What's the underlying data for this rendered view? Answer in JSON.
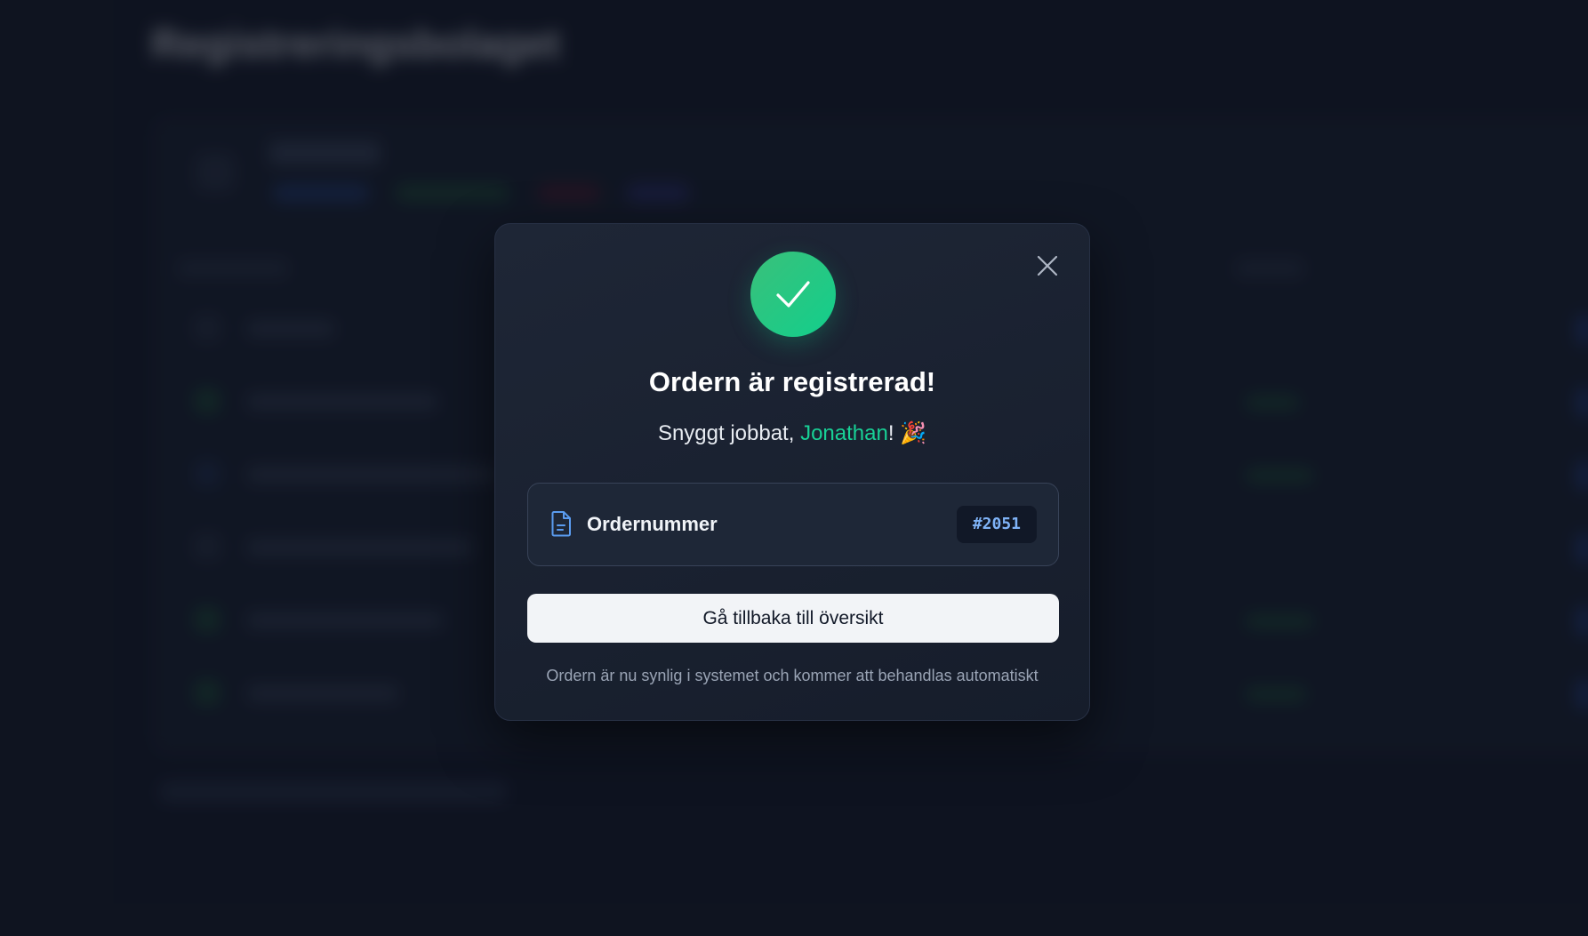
{
  "background": {
    "page_title": "Registreringsbolaget"
  },
  "modal": {
    "title": "Ordern är registrerad!",
    "greeting_prefix": "Snyggt jobbat, ",
    "user_name": "Jonathan",
    "greeting_suffix": "! 🎉",
    "order": {
      "label": "Ordernummer",
      "number": "#2051"
    },
    "back_button_label": "Gå tillbaka till översikt",
    "footnote": "Ordern är nu synlig i systemet och kommer att behandlas automatiskt"
  },
  "icons": {
    "success": "check-icon",
    "close": "close-icon",
    "order": "document-icon"
  },
  "colors": {
    "accent_green": "#18d196",
    "order_number": "#7fb3f7",
    "background": "#121826"
  }
}
